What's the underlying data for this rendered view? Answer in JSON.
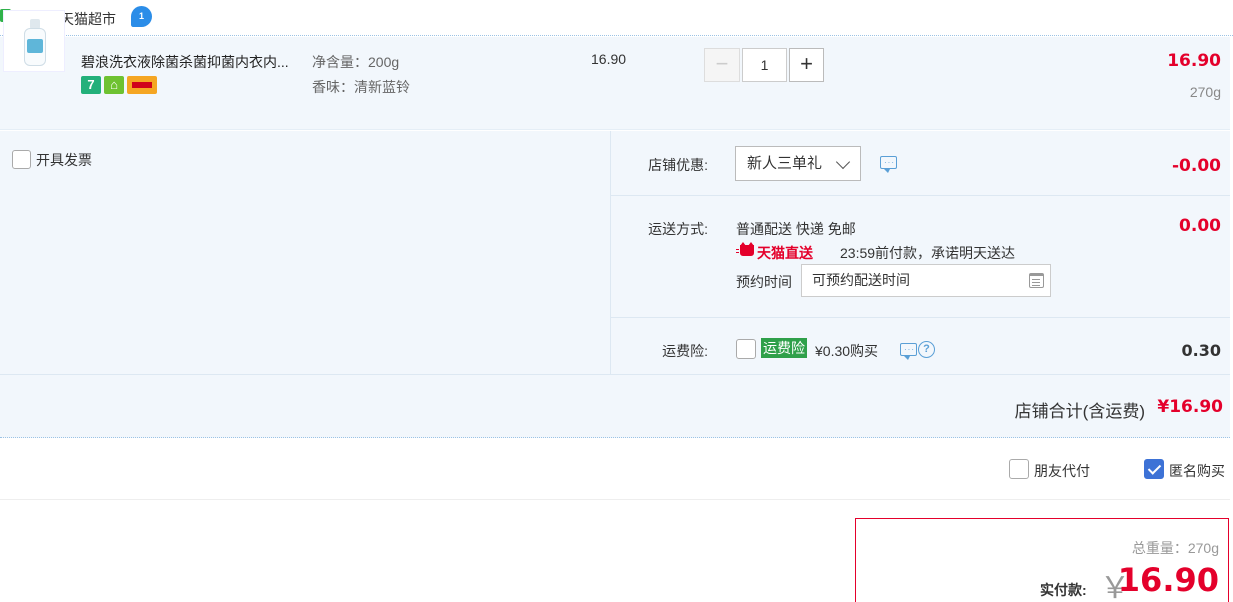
{
  "store": {
    "label": "店铺：天猫超市",
    "mini_icon_text": "天猫",
    "wangwang_text": "1"
  },
  "product": {
    "title": "碧浪洗衣液除菌杀菌抑菌内衣内...",
    "weight_attr": "净含量：200g",
    "scent_attr": "香味：清新蓝铃",
    "badge_seven": "7",
    "unit_price": "16.90",
    "quantity": "1",
    "qty_minus": "−",
    "qty_plus": "+",
    "line_total": "16.90",
    "line_weight": "270g"
  },
  "invoice": {
    "label": "开具发票"
  },
  "promo": {
    "label": "店铺优惠:",
    "selected": "新人三单礼",
    "amount": "-0.00"
  },
  "shipping": {
    "label": "运送方式:",
    "method": "普通配送 快递 免邮",
    "direct_label": "天猫直送",
    "promise": "23:59前付款，承诺明天送达",
    "schedule_label": "预约时间",
    "schedule_placeholder": "可预约配送时间",
    "amount": "0.00"
  },
  "insurance": {
    "label": "运费险:",
    "tag": "运费险",
    "price": "¥0.30购买",
    "help": "?",
    "amount": "0.30"
  },
  "store_total": {
    "label": "店铺合计(含运费)",
    "value": "¥16.90"
  },
  "options": {
    "friend_pay": "朋友代付",
    "anonymous": "匿名购买"
  },
  "summary": {
    "total_weight": "总重量：270g",
    "pay_label": "实付款:",
    "currency": "￥",
    "pay_amount": "16.90"
  },
  "colors": {
    "accent_red": "#e4002b",
    "panel_bg": "#f2f7fc",
    "insurance_green": "#2fa04a",
    "checkbox_blue": "#3d72d6"
  }
}
